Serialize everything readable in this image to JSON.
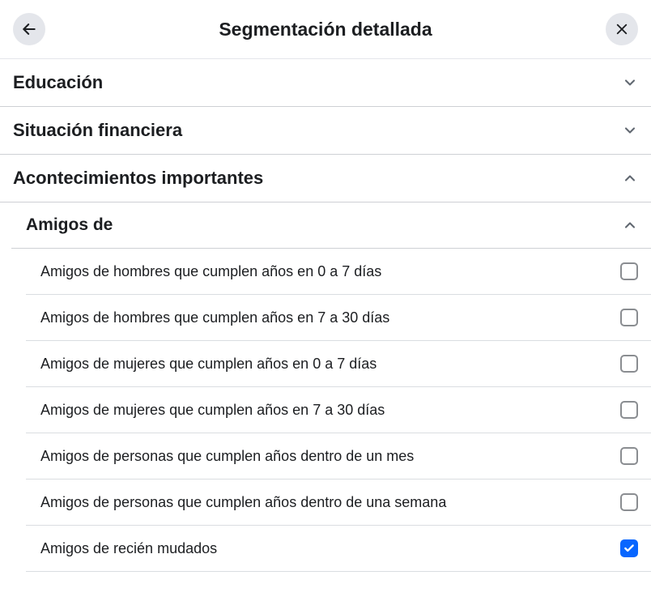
{
  "header": {
    "title": "Segmentación detallada"
  },
  "sections": [
    {
      "title": "Educación",
      "expanded": false
    },
    {
      "title": "Situación financiera",
      "expanded": false
    },
    {
      "title": "Acontecimientos importantes",
      "expanded": true
    }
  ],
  "subsection": {
    "title": "Amigos de",
    "expanded": true,
    "options": [
      {
        "label": "Amigos de hombres que cumplen años en 0 a 7 días",
        "checked": false
      },
      {
        "label": "Amigos de hombres que cumplen años en 7 a 30 días",
        "checked": false
      },
      {
        "label": "Amigos de mujeres que cumplen años en 0 a 7 días",
        "checked": false
      },
      {
        "label": "Amigos de mujeres que cumplen años en 7 a 30 días",
        "checked": false
      },
      {
        "label": "Amigos de personas que cumplen años dentro de un mes",
        "checked": false
      },
      {
        "label": "Amigos de personas que cumplen años dentro de una semana",
        "checked": false
      },
      {
        "label": "Amigos de recién mudados",
        "checked": true
      }
    ]
  }
}
